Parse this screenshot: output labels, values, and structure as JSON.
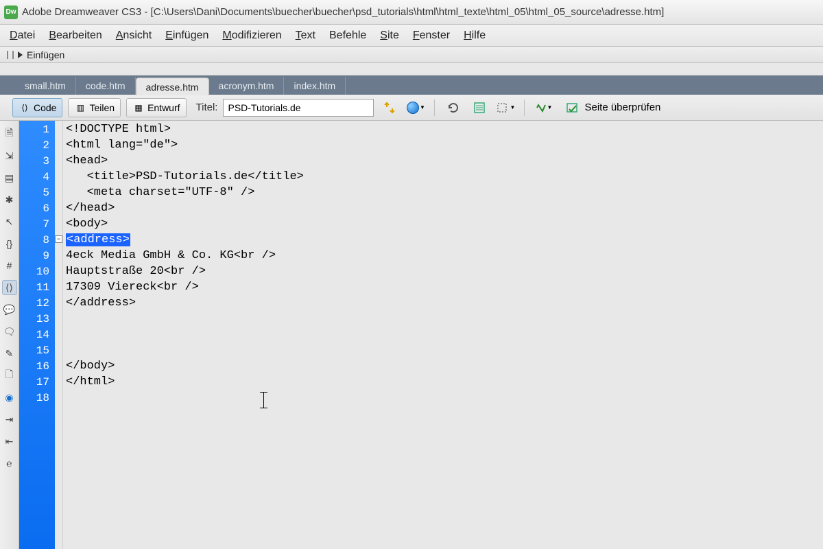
{
  "window": {
    "title": "Adobe Dreamweaver CS3 - [C:\\Users\\Dani\\Documents\\buecher\\buecher\\psd_tutorials\\html\\html_texte\\html_05\\html_05_source\\adresse.htm]",
    "app_icon_text": "Dw"
  },
  "menu": {
    "items": [
      "Datei",
      "Bearbeiten",
      "Ansicht",
      "Einfügen",
      "Modifizieren",
      "Text",
      "Befehle",
      "Site",
      "Fenster",
      "Hilfe"
    ]
  },
  "insert_panel": {
    "label": "Einfügen"
  },
  "tabs": {
    "items": [
      "small.htm",
      "code.htm",
      "adresse.htm",
      "acronym.htm",
      "index.htm"
    ],
    "active_index": 2
  },
  "viewbar": {
    "code": "Code",
    "split": "Teilen",
    "design": "Entwurf",
    "title_label": "Titel:",
    "title_value": "PSD-Tutorials.de",
    "check_site": "Seite überprüfen"
  },
  "code_lines": [
    "<!DOCTYPE html>",
    "<html lang=\"de\">",
    "<head>",
    "   <title>PSD-Tutorials.de</title>",
    "   <meta charset=\"UTF-8\" />",
    "</head>",
    "<body>",
    "<address>",
    "4eck Media GmbH & Co. KG<br />",
    "Hauptstraße 20<br />",
    "17309 Viereck<br />",
    "</address>",
    "",
    "",
    "",
    "</body>",
    "</html>",
    ""
  ],
  "highlighted_line_index": 7,
  "fold_marker_line": 7,
  "line_count": 18
}
